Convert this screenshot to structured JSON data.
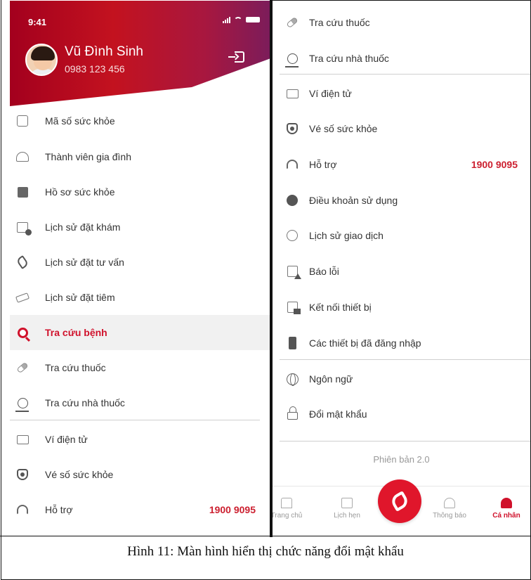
{
  "left_phone": {
    "status_time": "9:41",
    "user": {
      "name": "Vũ Đình Sinh",
      "phone": "0983 123 456"
    },
    "menu": [
      {
        "label": "Mã số sức khỏe",
        "icon": "qr-code-icon"
      },
      {
        "label": "Thành viên gia đình",
        "icon": "family-icon"
      },
      {
        "label": "Hồ sơ sức khỏe",
        "icon": "health-record-icon"
      },
      {
        "label": "Lịch sử đặt khám",
        "icon": "calendar-history-icon"
      },
      {
        "label": "Lịch sử đặt tư vấn",
        "icon": "phone-consult-icon"
      },
      {
        "label": "Lịch sử đặt tiêm",
        "icon": "syringe-icon"
      },
      {
        "label": "Tra cứu bệnh",
        "icon": "disease-search-icon",
        "active": true
      },
      {
        "label": "Tra cứu thuốc",
        "icon": "pill-icon"
      },
      {
        "label": "Tra cứu nhà thuốc",
        "icon": "pharmacy-pin-icon"
      },
      {
        "label": "Ví điện tử",
        "icon": "wallet-icon"
      },
      {
        "label": "Vé số sức khỏe",
        "icon": "shield-icon"
      },
      {
        "label": "Hỗ trợ",
        "icon": "headset-icon",
        "value": "1900 9095"
      }
    ]
  },
  "right_phone": {
    "menu": [
      {
        "label": "Tra cứu thuốc",
        "icon": "pill-icon"
      },
      {
        "label": "Tra cứu nhà thuốc",
        "icon": "pharmacy-pin-icon"
      },
      {
        "label": "Ví điện tử",
        "icon": "wallet-icon"
      },
      {
        "label": "Vé số sức khỏe",
        "icon": "shield-icon"
      },
      {
        "label": "Hỗ trợ",
        "icon": "headset-icon",
        "value": "1900 9095"
      },
      {
        "label": "Điều khoản sử dụng",
        "icon": "info-icon"
      },
      {
        "label": "Lịch sử giao dịch",
        "icon": "transaction-history-icon"
      },
      {
        "label": "Báo lỗi",
        "icon": "report-error-icon"
      },
      {
        "label": "Kết nối thiết bị",
        "icon": "connect-device-icon"
      },
      {
        "label": "Các thiết bị đã đăng nhập",
        "icon": "logged-devices-icon"
      },
      {
        "label": "Ngôn ngữ",
        "icon": "globe-icon"
      },
      {
        "label": "Đổi mật khẩu",
        "icon": "lock-icon"
      }
    ],
    "version": "Phiên bản 2.0",
    "bottom_nav": {
      "home": "Trang chủ",
      "schedule": "Lịch hẹn",
      "notifications": "Thông báo",
      "profile": "Cá nhân"
    }
  },
  "caption": "Hình 11: Màn hình hiển thị chức năng đổi mật khẩu",
  "colors": {
    "brand_red": "#d0112b",
    "header_purple": "#7c1c5a"
  }
}
